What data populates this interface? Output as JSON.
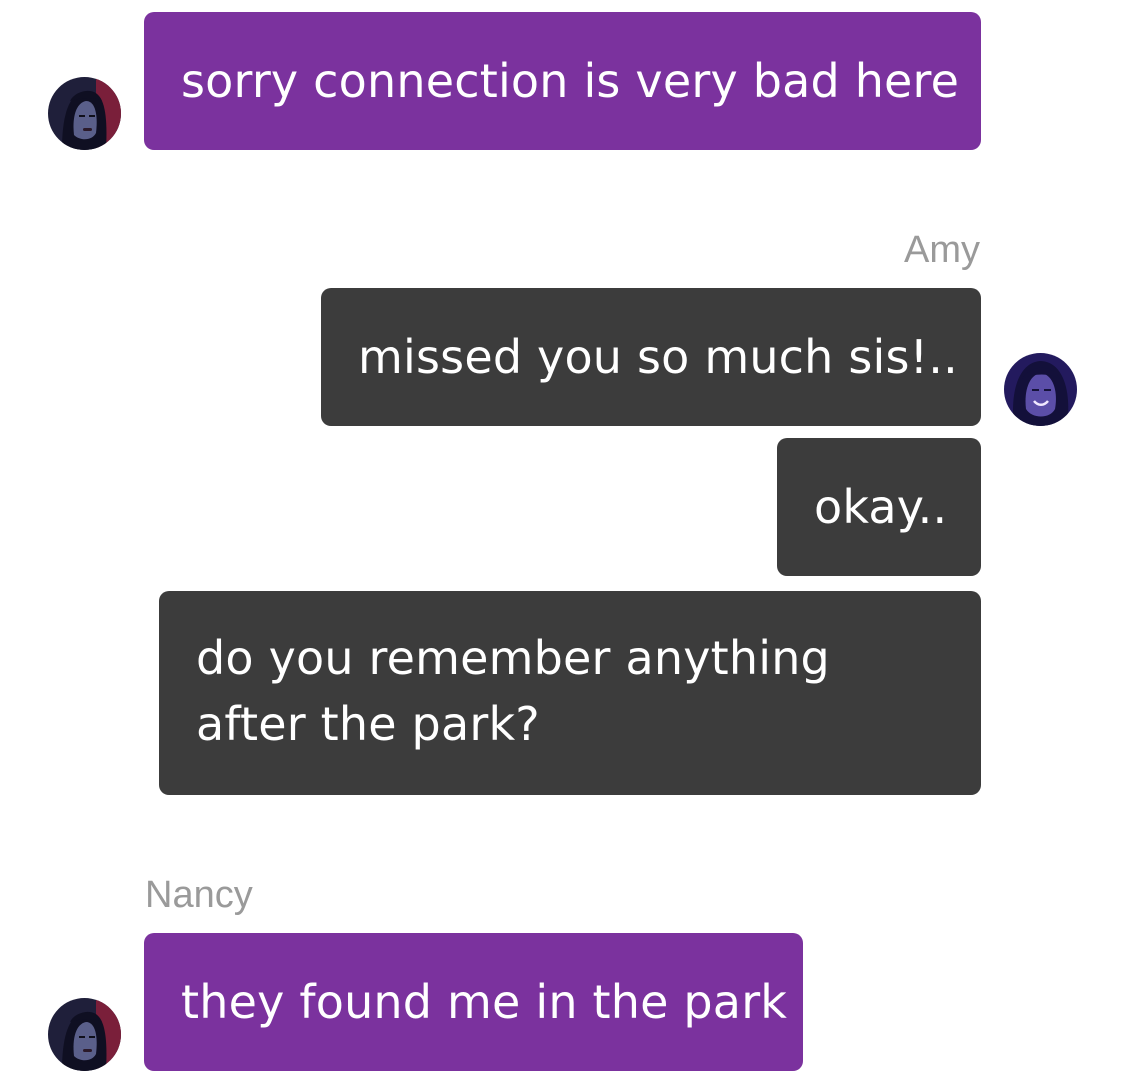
{
  "messages": [
    {
      "sender": "Nancy",
      "side": "left",
      "text": "sorry connection is very bad here"
    },
    {
      "sender": "Amy",
      "side": "right",
      "text": "missed you so much sis!.."
    },
    {
      "sender": "Amy",
      "side": "right",
      "text": "okay.."
    },
    {
      "sender": "Amy",
      "side": "right",
      "text": "do you remember anything after the park?"
    },
    {
      "sender": "Nancy",
      "side": "left",
      "text": "they found me in the park"
    }
  ],
  "labels": {
    "amy": "Amy",
    "nancy": "Nancy"
  },
  "avatars": {
    "nancy": {
      "icon": "nancy-avatar-icon",
      "accent": "#7a1f3a",
      "bg": "#1f1f3a"
    },
    "amy": {
      "icon": "amy-avatar-icon",
      "accent": "#3a2e8c",
      "bg": "#231a5e"
    }
  },
  "colors": {
    "nancy_bubble": "#7b329e",
    "amy_bubble": "#3c3c3c",
    "sender_label": "#9a9a9a"
  }
}
